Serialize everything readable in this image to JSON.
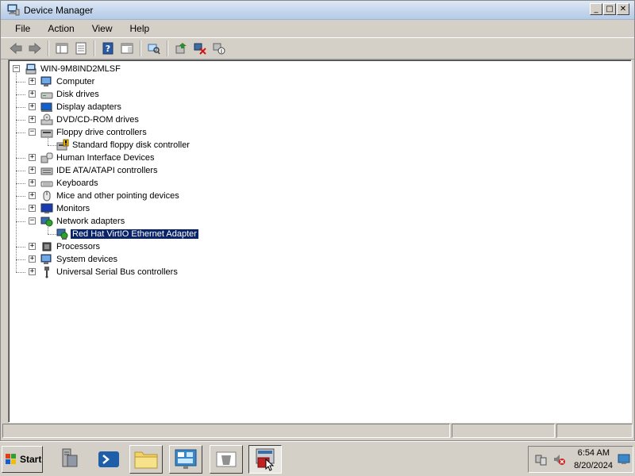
{
  "window": {
    "title": "Device Manager",
    "buttons": {
      "minimize": "_",
      "maximize": "□",
      "close": "✕"
    }
  },
  "menubar": [
    "File",
    "Action",
    "View",
    "Help"
  ],
  "toolbar": [
    "back-icon",
    "forward-icon",
    "show-hide-console-tree-icon",
    "properties-icon",
    "help-icon",
    "export-list-icon",
    "scan-hardware-icon",
    "update-driver-icon",
    "uninstall-icon",
    "disable-icon"
  ],
  "tree": {
    "root": "WIN-9M8IND2MLSF",
    "categories": [
      {
        "label": "Computer",
        "state": "collapsed",
        "icon": "computer-icon"
      },
      {
        "label": "Disk drives",
        "state": "collapsed",
        "icon": "disk-drive-icon"
      },
      {
        "label": "Display adapters",
        "state": "collapsed",
        "icon": "display-adapter-icon"
      },
      {
        "label": "DVD/CD-ROM drives",
        "state": "collapsed",
        "icon": "dvd-drive-icon"
      },
      {
        "label": "Floppy drive controllers",
        "state": "expanded",
        "icon": "floppy-controller-icon",
        "children": [
          {
            "label": "Standard floppy disk controller",
            "icon": "floppy-warning-icon"
          }
        ]
      },
      {
        "label": "Human Interface Devices",
        "state": "collapsed",
        "icon": "hid-icon"
      },
      {
        "label": "IDE ATA/ATAPI controllers",
        "state": "collapsed",
        "icon": "ide-controller-icon"
      },
      {
        "label": "Keyboards",
        "state": "collapsed",
        "icon": "keyboard-icon"
      },
      {
        "label": "Mice and other pointing devices",
        "state": "collapsed",
        "icon": "mouse-icon"
      },
      {
        "label": "Monitors",
        "state": "collapsed",
        "icon": "monitor-icon"
      },
      {
        "label": "Network adapters",
        "state": "expanded",
        "icon": "network-adapter-icon",
        "children": [
          {
            "label": "Red Hat VirtIO Ethernet Adapter",
            "icon": "network-card-icon",
            "selected": true
          }
        ]
      },
      {
        "label": "Processors",
        "state": "collapsed",
        "icon": "processor-icon"
      },
      {
        "label": "System devices",
        "state": "collapsed",
        "icon": "system-device-icon"
      },
      {
        "label": "Universal Serial Bus controllers",
        "state": "collapsed",
        "icon": "usb-icon"
      }
    ]
  },
  "taskbar": {
    "start_label": "Start",
    "apps": [
      "server-manager-icon",
      "powershell-icon",
      "explorer-folder-icon",
      "control-panel-icon",
      "recycle-icon",
      "device-manager-icon"
    ],
    "clock_time": "6:54 AM",
    "clock_date": "8/20/2024"
  },
  "colors": {
    "selection": "#0a246a",
    "title_gradient_top": "#dfe9f5",
    "title_gradient_bottom": "#b5cbe8",
    "chrome": "#d4d0c8"
  }
}
